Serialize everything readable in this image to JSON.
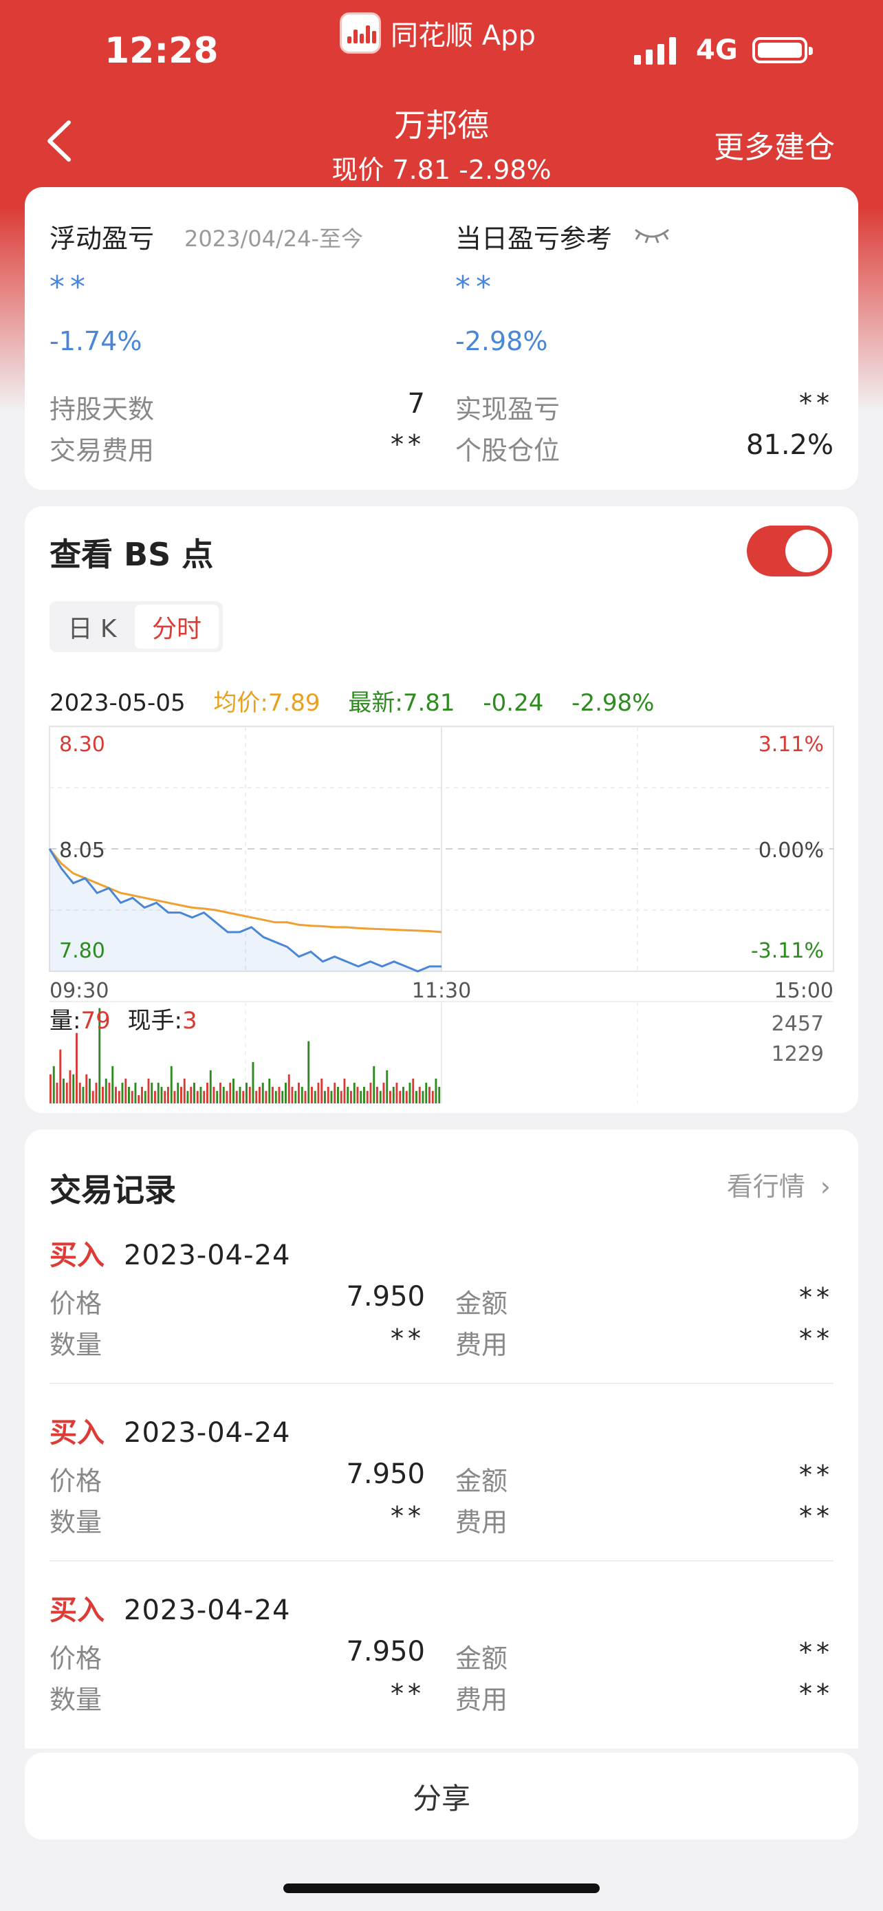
{
  "status_bar": {
    "time": "12:28",
    "app_name": "同花顺 App",
    "network": "4G"
  },
  "nav": {
    "title": "万邦德",
    "subtitle": "现价 7.81 -2.98%",
    "right_action": "更多建仓"
  },
  "summary": {
    "floating_pl_label": "浮动盈亏",
    "floating_pl_range": "2023/04/24-至今",
    "floating_pl_value": "**",
    "floating_pl_pct": "-1.74%",
    "daily_pl_label": "当日盈亏参考",
    "daily_pl_value": "**",
    "daily_pl_pct": "-2.98%",
    "hold_days_label": "持股天数",
    "hold_days_value": "7",
    "realized_label": "实现盈亏",
    "realized_value": "**",
    "fee_label": "交易费用",
    "fee_value": "**",
    "position_label": "个股仓位",
    "position_value": "81.2%"
  },
  "bs_section": {
    "title": "查看 BS 点",
    "toggle_on": true,
    "tabs": [
      "日 K",
      "分时"
    ],
    "active_tab": "分时",
    "quote": {
      "date": "2023-05-05",
      "avg": "均价:7.89",
      "latest": "最新:7.81",
      "change": "-0.24",
      "change_pct": "-2.98%"
    },
    "volume_label": "量:",
    "volume_value": "79",
    "hand_label": "现手:",
    "hand_value": "3",
    "colors": {
      "up": "#d93a34",
      "down": "#2e8b1f",
      "price": "#4a86d8",
      "avg": "#f0a030"
    }
  },
  "chart_data": {
    "type": "line",
    "x": [
      "09:30",
      "09:32",
      "09:34",
      "09:36",
      "09:38",
      "09:40",
      "09:42",
      "09:44",
      "09:46",
      "09:48",
      "09:50",
      "09:52",
      "09:54",
      "09:56",
      "09:58",
      "10:00",
      "10:05",
      "10:10",
      "10:15",
      "10:20",
      "10:25",
      "10:30",
      "10:35",
      "10:40",
      "10:45",
      "10:50",
      "10:55",
      "11:00",
      "11:05",
      "11:10",
      "11:15",
      "11:20",
      "11:25",
      "11:30"
    ],
    "series": [
      {
        "values": [
          8.05,
          8.01,
          7.98,
          7.99,
          7.96,
          7.97,
          7.94,
          7.95,
          7.93,
          7.94,
          7.92,
          7.92,
          7.91,
          7.92,
          7.9,
          7.88,
          7.88,
          7.89,
          7.87,
          7.86,
          7.85,
          7.83,
          7.84,
          7.82,
          7.83,
          7.82,
          7.81,
          7.82,
          7.81,
          7.82,
          7.81,
          7.8,
          7.81,
          7.81
        ]
      },
      {
        "values": [
          8.05,
          8.02,
          8.0,
          7.99,
          7.98,
          7.97,
          7.96,
          7.955,
          7.95,
          7.945,
          7.94,
          7.935,
          7.93,
          7.928,
          7.925,
          7.92,
          7.915,
          7.91,
          7.905,
          7.9,
          7.9,
          7.895,
          7.893,
          7.892,
          7.89,
          7.89,
          7.888,
          7.887,
          7.886,
          7.885,
          7.884,
          7.883,
          7.882,
          7.88
        ]
      }
    ],
    "y_price_ticks": [
      "8.30",
      "8.05",
      "7.80"
    ],
    "y_pct_ticks": [
      "3.11%",
      "0.00%",
      "-3.11%"
    ],
    "x_ticks": [
      "09:30",
      "11:30",
      "15:00"
    ],
    "ylim": [
      7.8,
      8.3
    ],
    "volume": {
      "ticks": [
        "2457",
        "1229"
      ],
      "ylim": [
        0,
        2457
      ],
      "values": [
        700,
        900,
        500,
        1300,
        600,
        500,
        800,
        700,
        1700,
        500,
        400,
        700,
        600,
        300,
        500,
        2300,
        400,
        600,
        500,
        900,
        400,
        300,
        500,
        600,
        400,
        300,
        500,
        200,
        400,
        300,
        600,
        500,
        300,
        500,
        400,
        300,
        400,
        900,
        300,
        500,
        400,
        600,
        300,
        400,
        500,
        300,
        400,
        300,
        500,
        800,
        400,
        300,
        500,
        400,
        300,
        500,
        600,
        300,
        400,
        300,
        500,
        400,
        1000,
        300,
        400,
        500,
        300,
        600,
        400,
        300,
        400,
        300,
        500,
        700,
        400,
        300,
        500,
        400,
        300,
        1500,
        400,
        300,
        500,
        600,
        300,
        400,
        300,
        500,
        400,
        300,
        600,
        400,
        300,
        500,
        400,
        300,
        400,
        300,
        500,
        900,
        400,
        300,
        500,
        800,
        300,
        400,
        500,
        300,
        400,
        300,
        500,
        600,
        300,
        400,
        300,
        500,
        400,
        300,
        600,
        400
      ],
      "up": [
        1,
        0,
        1,
        1,
        0,
        1,
        1,
        0,
        1,
        1,
        0,
        1,
        0,
        1,
        1,
        0,
        1,
        0,
        1,
        0,
        1,
        1,
        0,
        1,
        0,
        1,
        0,
        1,
        1,
        0,
        1,
        0,
        1,
        0,
        0,
        1,
        1,
        0,
        1,
        0,
        1,
        1,
        0,
        1,
        0,
        1,
        0,
        1,
        1,
        0,
        1,
        0,
        1,
        0,
        1,
        1,
        0,
        1,
        0,
        1,
        0,
        1,
        0,
        1,
        1,
        0,
        1,
        0,
        1,
        0,
        1,
        0,
        0,
        1,
        1,
        0,
        1,
        0,
        1,
        0,
        1,
        0,
        1,
        1,
        0,
        1,
        0,
        1,
        0,
        1,
        1,
        0,
        1,
        0,
        1,
        0,
        0,
        1,
        1,
        0,
        1,
        0,
        1,
        0,
        1,
        0,
        1,
        1,
        0,
        1,
        0,
        1,
        0,
        1,
        0,
        0,
        1,
        1,
        0
      ]
    }
  },
  "records": {
    "title": "交易记录",
    "view_market": "看行情",
    "items": [
      {
        "type": "买入",
        "date": "2023-04-24",
        "price_label": "价格",
        "price": "7.950",
        "amount_label": "金额",
        "amount": "**",
        "qty_label": "数量",
        "qty": "**",
        "fee_label": "费用",
        "fee": "**"
      },
      {
        "type": "买入",
        "date": "2023-04-24",
        "price_label": "价格",
        "price": "7.950",
        "amount_label": "金额",
        "amount": "**",
        "qty_label": "数量",
        "qty": "**",
        "fee_label": "费用",
        "fee": "**"
      },
      {
        "type": "买入",
        "date": "2023-04-24",
        "price_label": "价格",
        "price": "7.950",
        "amount_label": "金额",
        "amount": "**",
        "qty_label": "数量",
        "qty": "**",
        "fee_label": "费用",
        "fee": "**"
      }
    ]
  },
  "share_label": "分享"
}
